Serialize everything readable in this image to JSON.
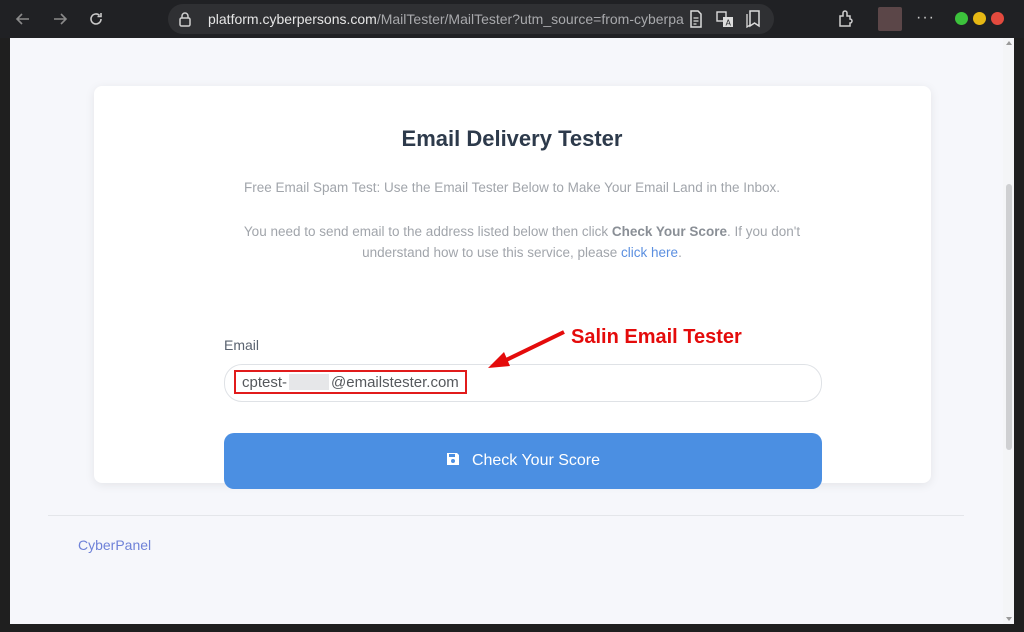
{
  "browser": {
    "url_domain": "platform.cyberpersons.com",
    "url_path": "/MailTester/MailTester?utm_source=from-cyberpa",
    "icons": [
      "back-arrow-icon",
      "forward-arrow-icon",
      "reload-icon",
      "lock-icon",
      "reader-icon",
      "translate-icon",
      "bookmark-icon",
      "extensions-icon",
      "menu-dots-icon"
    ],
    "menu_dots": "···"
  },
  "card": {
    "title": "Email Delivery Tester",
    "subtitle": "Free Email Spam Test: Use the Email Tester Below to Make Your Email Land in the Inbox.",
    "instructions_part1": "You need to send email to the address listed below then click ",
    "instructions_bold": "Check Your Score",
    "instructions_part2": ". If you don't understand how to use this service, please ",
    "instructions_link": "click here",
    "instructions_end": ".",
    "email_label": "Email",
    "email_prefix": "cptest-",
    "email_suffix": "@emailstester.com",
    "button_label": "Check Your Score",
    "button_icon": "save-icon"
  },
  "annotation": {
    "text": "Salin Email Tester",
    "color": "#e40b0b"
  },
  "footer": {
    "link": "CyberPanel"
  },
  "colors": {
    "button": "#4b8fe2",
    "link": "#5b8fe0",
    "title": "#2d3a4b"
  }
}
